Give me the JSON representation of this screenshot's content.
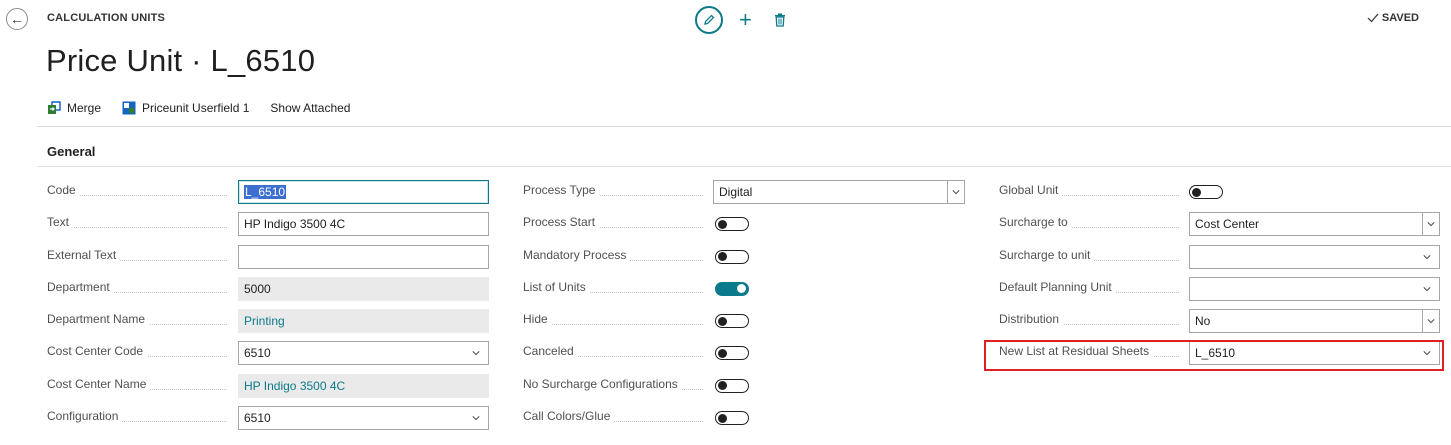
{
  "header": {
    "breadcrumb": "CALCULATION UNITS",
    "title": "Price Unit · L_6510",
    "status": "SAVED"
  },
  "toolbar": {
    "actions": [
      {
        "label": "Merge",
        "icon": "merge-icon"
      },
      {
        "label": "Priceunit Userfield 1",
        "icon": "userfield-icon"
      },
      {
        "label": "Show Attached",
        "icon": ""
      }
    ]
  },
  "section": {
    "title": "General"
  },
  "columns": [
    {
      "fields": [
        {
          "label": "Code",
          "value": "L_6510",
          "type": "text-focused"
        },
        {
          "label": "Text",
          "value": "HP Indigo 3500 4C",
          "type": "text"
        },
        {
          "label": "External Text",
          "value": "",
          "type": "text"
        },
        {
          "label": "Department",
          "value": "5000",
          "type": "readonly"
        },
        {
          "label": "Department Name",
          "value": "Printing",
          "type": "readonly-link"
        },
        {
          "label": "Cost Center Code",
          "value": "6510",
          "type": "select"
        },
        {
          "label": "Cost Center Name",
          "value": "HP Indigo 3500 4C",
          "type": "readonly-link"
        },
        {
          "label": "Configuration",
          "value": "6510",
          "type": "select"
        }
      ]
    },
    {
      "fields": [
        {
          "label": "Process Type",
          "value": "Digital",
          "type": "dropdown"
        },
        {
          "label": "Process Start",
          "value": false,
          "type": "toggle"
        },
        {
          "label": "Mandatory Process",
          "value": false,
          "type": "toggle"
        },
        {
          "label": "List of Units",
          "value": true,
          "type": "toggle"
        },
        {
          "label": "Hide",
          "value": false,
          "type": "toggle"
        },
        {
          "label": "Canceled",
          "value": false,
          "type": "toggle"
        },
        {
          "label": "No Surcharge Configurations",
          "value": false,
          "type": "toggle"
        },
        {
          "label": "Call Colors/Glue",
          "value": false,
          "type": "toggle"
        }
      ]
    },
    {
      "fields": [
        {
          "label": "Global Unit",
          "value": false,
          "type": "toggle"
        },
        {
          "label": "Surcharge to",
          "value": "Cost Center",
          "type": "dropdown"
        },
        {
          "label": "Surcharge to unit",
          "value": "",
          "type": "select"
        },
        {
          "label": "Default Planning Unit",
          "value": "",
          "type": "select"
        },
        {
          "label": "Distribution",
          "value": "No",
          "type": "dropdown"
        },
        {
          "label": "New List at Residual Sheets",
          "value": "L_6510",
          "type": "select"
        }
      ]
    }
  ],
  "colors": {
    "accent": "#0b7a8a",
    "highlight": "#e02020"
  }
}
